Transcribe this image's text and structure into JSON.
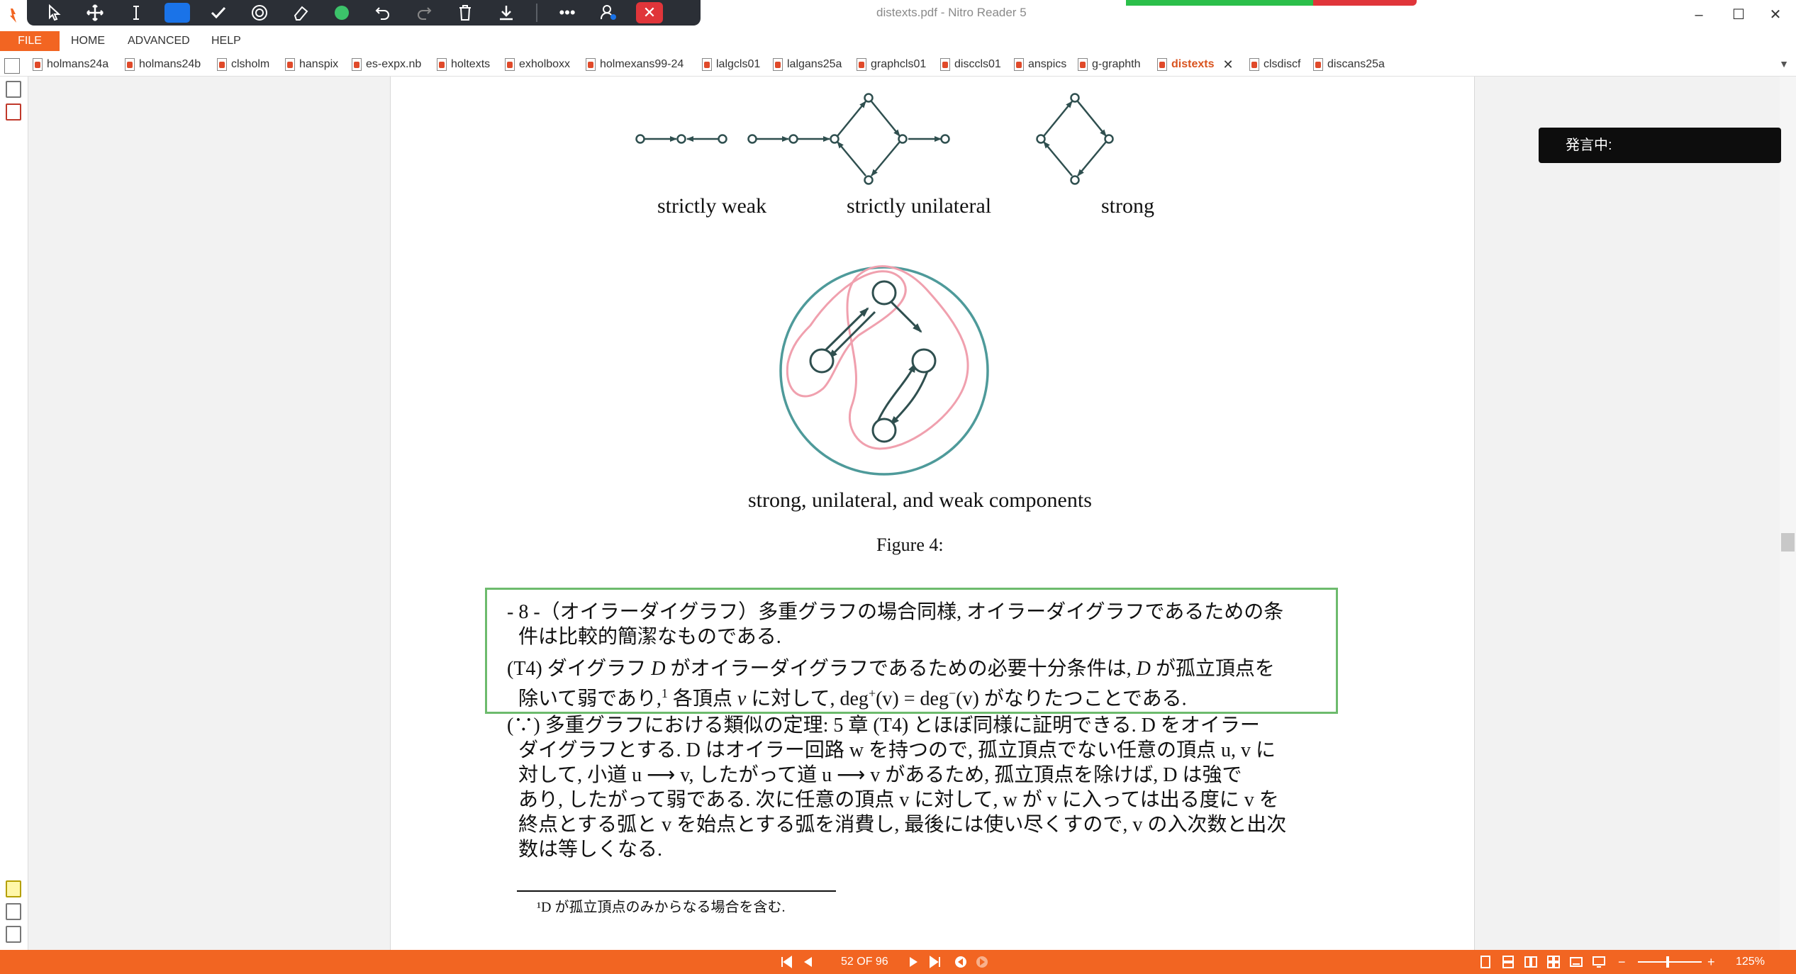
{
  "window": {
    "title": "distexts.pdf - Nitro Reader 5",
    "minimize": "–",
    "maximize": "☐",
    "close": "✕"
  },
  "toolbar": {
    "more": "•••"
  },
  "ribbon": {
    "file": "FILE",
    "home": "HOME",
    "advanced": "ADVANCED",
    "help": "HELP"
  },
  "tabs": [
    {
      "label": "holmans24a"
    },
    {
      "label": "holmans24b"
    },
    {
      "label": "clsholm"
    },
    {
      "label": "hanspix"
    },
    {
      "label": "es-expx.nb"
    },
    {
      "label": "holtexts"
    },
    {
      "label": "exholboxx"
    },
    {
      "label": "holmexans99-24"
    },
    {
      "label": "lalgcls01"
    },
    {
      "label": "lalgans25a"
    },
    {
      "label": "graphcls01"
    },
    {
      "label": "disccls01"
    },
    {
      "label": "anspics"
    },
    {
      "label": "g-graphth"
    },
    {
      "label": "distexts"
    },
    {
      "label": "clsdiscf"
    },
    {
      "label": "discans25a"
    }
  ],
  "tab_close": "✕",
  "tabs_dropdown": "▼",
  "figure": {
    "label_weak": "strictly weak",
    "label_unilateral": "strictly unilateral",
    "label_strong": "strong",
    "label_components": "strong, unilateral, and weak components",
    "caption": "Figure 4:",
    "colors": {
      "node": "#2f4f4f",
      "circle": "#4e9a9a",
      "blob": "#f0a0ae"
    }
  },
  "text": {
    "line1": "- 8 -（オイラーダイグラフ）多重グラフの場合同様, オイラーダイグラフであるための条",
    "line2": "件は比較的簡潔なものである.",
    "t4_a": "(T4)  ダイグラフ ",
    "t4_D": "D",
    "t4_b": " がオイラーダイグラフであるための必要十分条件は, ",
    "t4_D2": "D",
    "t4_c": " が孤立頂点を",
    "t4_line2_a": "除いて弱であり,",
    "t4_sup": "1",
    "t4_line2_b": " 各頂点 ",
    "t4_v": "v",
    "t4_line2_c": " に対して, deg",
    "t4_plus": "+",
    "t4_line2_d": "(v) = deg",
    "t4_minus": "−",
    "t4_line2_e": "(v) がなりたつことである.",
    "proof1": "(∵) 多重グラフにおける類似の定理: 5 章 (T4) とほぼ同様に証明できる. D をオイラー",
    "proof2": "ダイグラフとする. D はオイラー回路 w を持つので, 孤立頂点でない任意の頂点 u, v に",
    "proof3": "対して, 小道 u ⟶ v, したがって道 u ⟶ v があるため, 孤立頂点を除けば, D は強で",
    "proof4": "あり, したがって弱である. 次に任意の頂点 v に対して, w が v に入っては出る度に v を",
    "proof5": "終点とする弧と v を始点とする弧を消費し, 最後には使い尽くすので, v の入次数と出次",
    "proof6": "数は等しくなる.",
    "footnote": "¹D が孤立頂点のみからなる場合を含む."
  },
  "overlay": {
    "speaking": "発言中:"
  },
  "statusbar": {
    "page": "52 OF 96",
    "zoom": "125%",
    "zoom_minus": "−",
    "zoom_plus": "+"
  }
}
